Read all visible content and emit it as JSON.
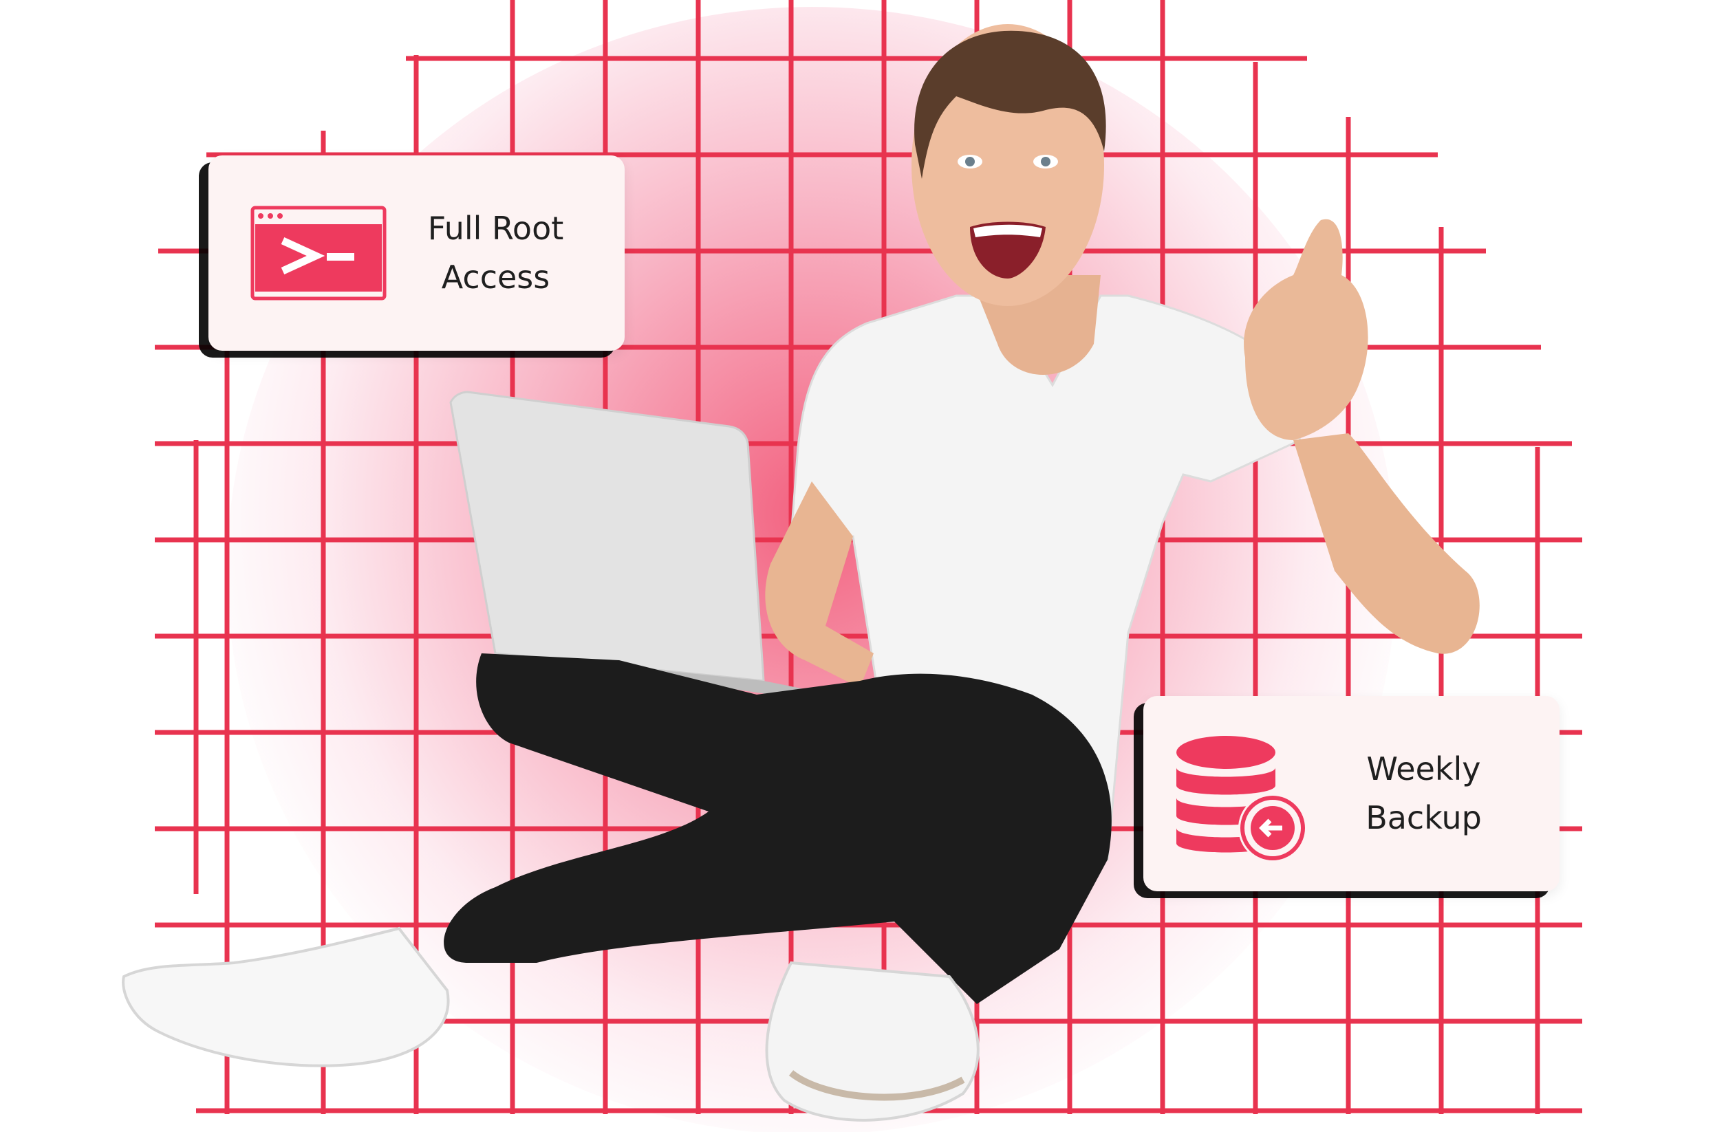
{
  "cards": {
    "root_access": {
      "icon": "terminal-icon",
      "line1": "Full Root",
      "line2": "Access"
    },
    "weekly_backup": {
      "icon": "database-backup-icon",
      "line1": "Weekly",
      "line2": "Backup"
    }
  },
  "colors": {
    "accent": "#ee3a5e",
    "grid": "#e8334f",
    "card_bg": "#fdf3f3",
    "text": "#1f1f1f"
  }
}
